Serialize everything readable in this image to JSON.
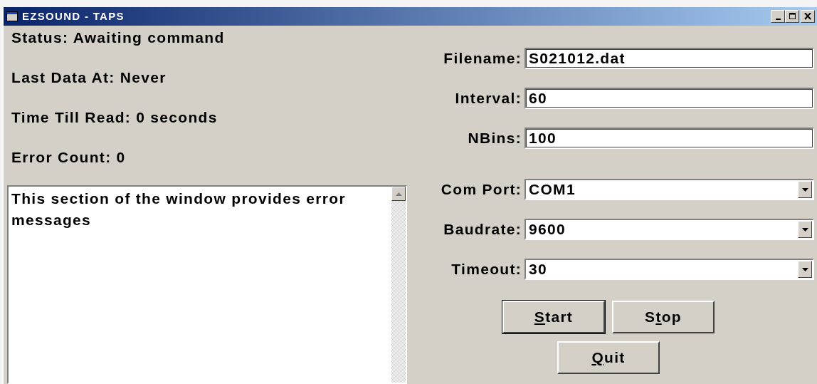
{
  "window": {
    "title": "EZSOUND - TAPS",
    "controls": [
      {
        "kind": "minimize"
      },
      {
        "kind": "maximize"
      },
      {
        "kind": "close"
      }
    ]
  },
  "status_lines": [
    "Status: Awaiting command",
    "Last Data At: Never",
    "Time Till Read: 0 seconds",
    "Error Count: 0"
  ],
  "message_area": {
    "text": "This section of the window provides error messages"
  },
  "fields": [
    {
      "kind": "text",
      "label": "Filename:",
      "value": "S021012.dat"
    },
    {
      "kind": "text",
      "label": "Interval:",
      "value": "60"
    },
    {
      "kind": "text",
      "label": "NBins:",
      "value": "100"
    },
    {
      "kind": "combo",
      "label": "Com Port:",
      "value": "COM1"
    },
    {
      "kind": "combo",
      "label": "Baudrate:",
      "value": "9600"
    },
    {
      "kind": "combo",
      "label": "Timeout:",
      "value": "30"
    }
  ],
  "buttons": [
    {
      "label": "Start",
      "default": true
    },
    {
      "label": "Stop",
      "default": false
    },
    {
      "label": "Quit",
      "default": false
    }
  ]
}
